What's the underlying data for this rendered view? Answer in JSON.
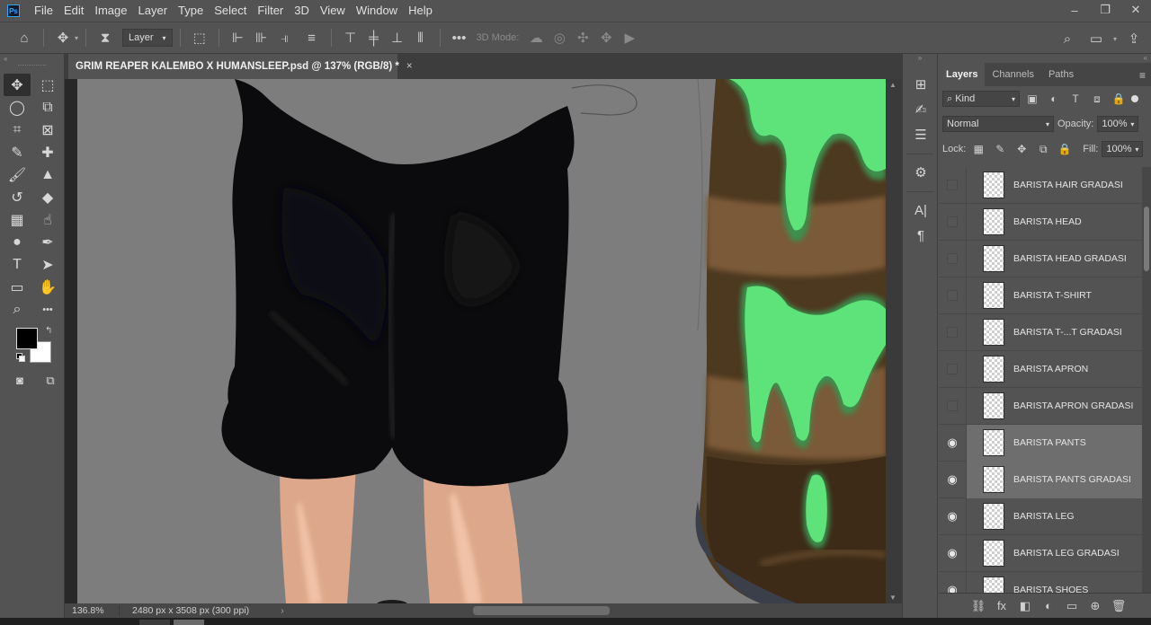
{
  "menu": {
    "logo": "Ps",
    "items": [
      "File",
      "Edit",
      "Image",
      "Layer",
      "Type",
      "Select",
      "Filter",
      "3D",
      "View",
      "Window",
      "Help"
    ]
  },
  "window_controls": {
    "minimize": "–",
    "restore": "❐",
    "close": "✕"
  },
  "options": {
    "home": "⌂",
    "move": "✥",
    "auto_select": "Layer",
    "mode_label": "3D Mode:",
    "more": "•••",
    "search": "⌕",
    "share": "⇪"
  },
  "tools": [
    {
      "name": "move-tool",
      "glyph": "✥",
      "active": true
    },
    {
      "name": "marquee-tool",
      "glyph": "⬚"
    },
    {
      "name": "lasso-tool",
      "glyph": "◯"
    },
    {
      "name": "object-select-tool",
      "glyph": "⧉"
    },
    {
      "name": "crop-tool",
      "glyph": "⌗"
    },
    {
      "name": "frame-tool",
      "glyph": "⊠"
    },
    {
      "name": "eyedropper-tool",
      "glyph": "✎"
    },
    {
      "name": "healing-tool",
      "glyph": "✚"
    },
    {
      "name": "brush-tool",
      "glyph": "🖌"
    },
    {
      "name": "stamp-tool",
      "glyph": "▲"
    },
    {
      "name": "history-brush-tool",
      "glyph": "↺"
    },
    {
      "name": "eraser-tool",
      "glyph": "◆"
    },
    {
      "name": "gradient-tool",
      "glyph": "▦"
    },
    {
      "name": "smudge-tool",
      "glyph": "☝"
    },
    {
      "name": "dodge-tool",
      "glyph": "●"
    },
    {
      "name": "pen-tool",
      "glyph": "✒"
    },
    {
      "name": "type-tool",
      "glyph": "T"
    },
    {
      "name": "path-select-tool",
      "glyph": "➤"
    },
    {
      "name": "shape-tool",
      "glyph": "▭"
    },
    {
      "name": "hand-tool",
      "glyph": "✋"
    },
    {
      "name": "zoom-tool",
      "glyph": "⌕"
    },
    {
      "name": "more-tools",
      "glyph": "•••"
    }
  ],
  "colors": {
    "foreground": "#000000",
    "background": "#ffffff",
    "slime": "#5de37a",
    "skin": "#dca78a"
  },
  "document": {
    "tab_title": "GRIM REAPER KALEMBO X HUMANSLEEP.psd @ 137% (RGB/8) *",
    "close": "×",
    "zoom": "136.8%",
    "dimensions": "2480 px x 3508 px (300 ppi)",
    "chevron": "›"
  },
  "middock": {
    "icons": [
      "⊞",
      "✍",
      "☰",
      "⚙",
      "A|",
      "¶"
    ]
  },
  "layers_panel": {
    "tabs": [
      "Layers",
      "Channels",
      "Paths"
    ],
    "filter_kind": "Kind",
    "blend_mode": "Normal",
    "opacity_label": "Opacity:",
    "opacity": "100%",
    "lock_label": "Lock:",
    "fill_label": "Fill:",
    "fill": "100%",
    "layers": [
      {
        "name": "BARISTA HAIR GRADASI",
        "visible": false,
        "selected": false
      },
      {
        "name": "BARISTA HEAD",
        "visible": false,
        "selected": false
      },
      {
        "name": "BARISTA HEAD GRADASI",
        "visible": false,
        "selected": false
      },
      {
        "name": "BARISTA T-SHIRT",
        "visible": false,
        "selected": false
      },
      {
        "name": "BARISTA T-...T GRADASI",
        "visible": false,
        "selected": false
      },
      {
        "name": "BARISTA APRON",
        "visible": false,
        "selected": false
      },
      {
        "name": "BARISTA APRON GRADASI",
        "visible": false,
        "selected": false
      },
      {
        "name": "BARISTA PANTS",
        "visible": true,
        "selected": true
      },
      {
        "name": "BARISTA PANTS GRADASI",
        "visible": true,
        "selected": true
      },
      {
        "name": "BARISTA LEG",
        "visible": true,
        "selected": false
      },
      {
        "name": "BARISTA LEG GRADASI",
        "visible": true,
        "selected": false
      },
      {
        "name": "BARISTA SHOES",
        "visible": true,
        "selected": false
      }
    ],
    "footer_icons": [
      "⛓",
      "fx",
      "◧",
      "◐",
      "▭",
      "⊕",
      "🗑"
    ]
  }
}
